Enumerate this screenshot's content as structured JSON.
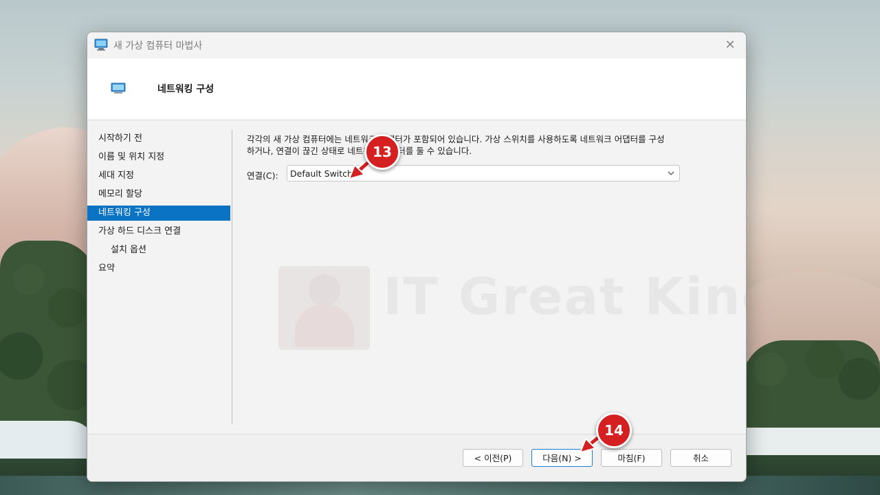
{
  "window": {
    "title": "새 가상 컴퓨터 마법사",
    "close_glyph": "✕"
  },
  "header": {
    "title": "네트워킹 구성"
  },
  "nav": {
    "items": [
      {
        "label": "시작하기 전"
      },
      {
        "label": "이름 및 위치 지정"
      },
      {
        "label": "세대 지정"
      },
      {
        "label": "메모리 할당"
      },
      {
        "label": "네트워킹 구성",
        "active": true
      },
      {
        "label": "가상 하드 디스크 연결"
      },
      {
        "label": "설치 옵션",
        "sub": true
      },
      {
        "label": "요약"
      }
    ]
  },
  "content": {
    "description_line1": "각각의 새 가상 컴퓨터에는 네트워크 어댑터가 포함되어 있습니다. 가상 스위치를 사용하도록 네트워크 어댑터를 구성",
    "description_line2": "하거나, 연결이 끊긴 상태로 네트워크 어댑터를 둘 수 있습니다.",
    "connection_label": "연결(C):",
    "connection_value": "Default Switch"
  },
  "watermark": {
    "text": "IT Great King"
  },
  "footer": {
    "prev_label": "< 이전(P)",
    "next_label": "다음(N) >",
    "finish_label": "마침(F)",
    "cancel_label": "취소"
  },
  "callouts": {
    "step13": "13",
    "step14": "14"
  },
  "colors": {
    "accent": "#0a73c4",
    "callout": "#d42020",
    "dialog_bg": "#f3f3f3"
  },
  "icons": {
    "title": "computer-icon",
    "header": "computer-icon",
    "dropdown": "chevron-down-icon",
    "close": "close-icon"
  }
}
